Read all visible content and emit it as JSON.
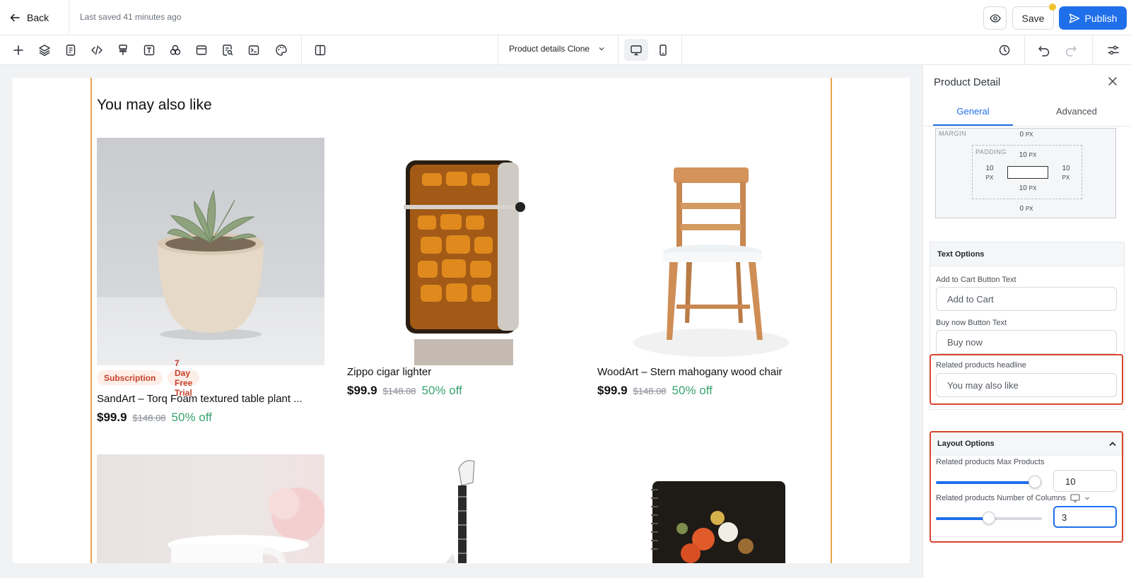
{
  "header": {
    "back_label": "Back",
    "last_saved": "Last saved 41 minutes ago",
    "save_label": "Save",
    "publish_label": "Publish"
  },
  "toolbar": {
    "tools": [
      "add-icon",
      "layers-icon",
      "page-icon",
      "code-icon",
      "paint-roller-icon",
      "text-icon",
      "components-icon",
      "layout-icon",
      "search-doc-icon",
      "terminal-icon",
      "palette-icon",
      "columns-icon"
    ],
    "page_selector": "Product details Clone",
    "devices": [
      "desktop-icon",
      "mobile-icon"
    ],
    "right_tools": [
      "history-icon",
      "undo-icon",
      "redo-icon",
      "settings-sliders-icon"
    ]
  },
  "canvas": {
    "headline": "You may also like",
    "products": [
      {
        "name": "SandArt – Torq Foam textured table plant ...",
        "price": "$99.9",
        "was": "$148.08",
        "off": "50% off",
        "tags": [
          "Subscription",
          "7 Day Free Trial"
        ]
      },
      {
        "name": "Zippo cigar lighter",
        "price": "$99.9",
        "was": "$148.08",
        "off": "50% off",
        "tags": []
      },
      {
        "name": "WoodArt – Stern mahogany wood chair",
        "price": "$99.9",
        "was": "$148.08",
        "off": "50% off",
        "tags": []
      }
    ]
  },
  "panel": {
    "title": "Product Detail",
    "tabs": [
      "General",
      "Advanced"
    ],
    "active_tab": "General",
    "box_model": {
      "margin_label": "MARGIN",
      "padding_label": "PADDING",
      "margin_top": "0",
      "margin_bottom": "0",
      "padding_top": "10",
      "padding_bottom": "10",
      "padding_left": "10",
      "padding_right": "10",
      "unit": "PX"
    },
    "text_options": {
      "title": "Text Options",
      "add_to_cart_label": "Add to Cart Button Text",
      "add_to_cart_value": "Add to Cart",
      "buy_now_label": "Buy now Button Text",
      "buy_now_value": "Buy now",
      "related_headline_label": "Related products headline",
      "related_headline_value": "You may also like"
    },
    "layout_options": {
      "title": "Layout Options",
      "max_products_label": "Related products Max Products",
      "max_products_value": "10",
      "max_products_fraction": 0.93,
      "columns_label": "Related products Number of Columns",
      "columns_value": "3",
      "columns_fraction": 0.5
    }
  },
  "colors": {
    "accent": "#1f6feb",
    "highlight": "#d9442e",
    "guide": "#e8a24a",
    "tag_text": "#c7402a",
    "discount": "#3aa370"
  }
}
